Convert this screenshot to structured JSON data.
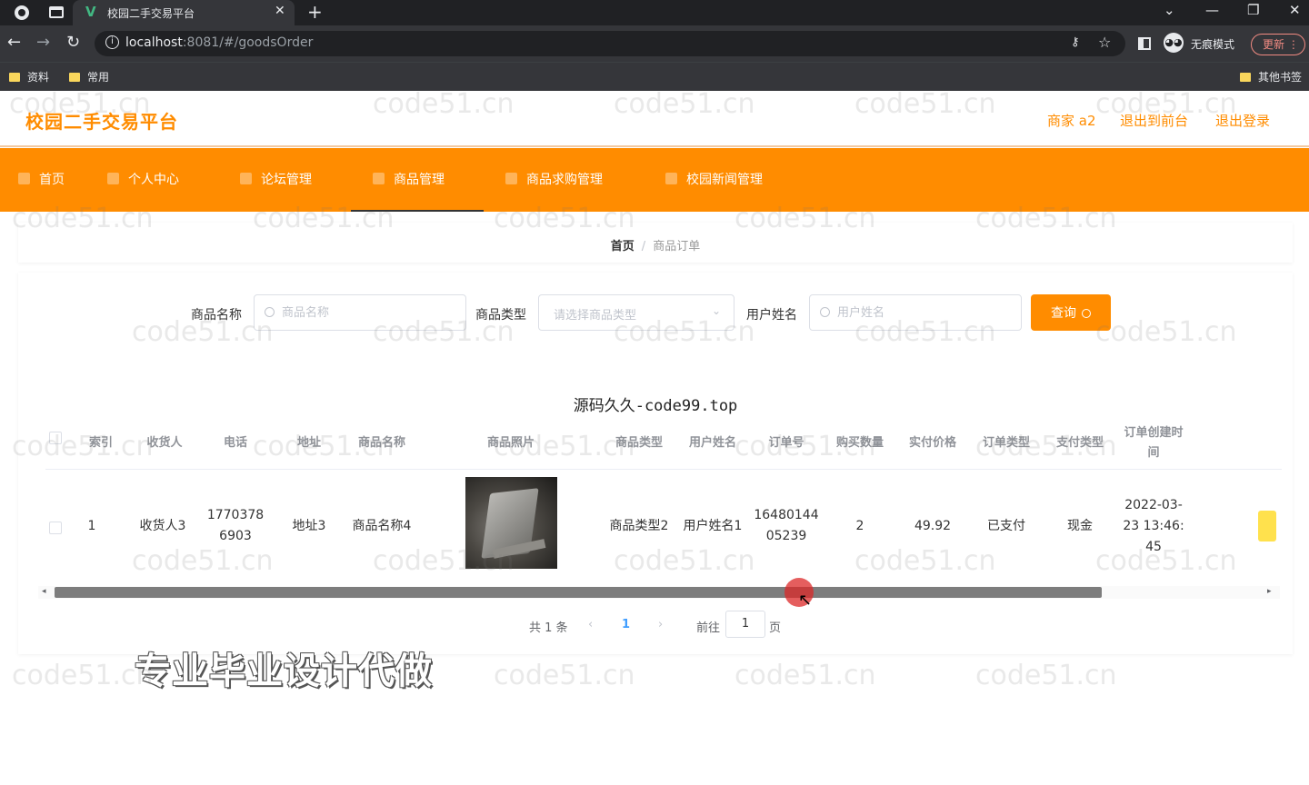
{
  "browser": {
    "tab_title": "校园二手交易平台",
    "tab_close": "✕",
    "new_tab": "+",
    "url_host": "localhost",
    "url_path": ":8081/#/goodsOrder",
    "incognito_label": "无痕模式",
    "update_label": "更新",
    "bookmarks": [
      "资料",
      "常用"
    ],
    "other_bookmarks": "其他书签"
  },
  "header": {
    "site_title": "校园二手交易平台",
    "merchant": "商家 a2",
    "back_to_front": "退出到前台",
    "logout": "退出登录"
  },
  "nav": {
    "items": [
      "首页",
      "个人中心",
      "论坛管理",
      "商品管理",
      "商品求购管理",
      "校园新闻管理"
    ],
    "active_index": 3
  },
  "breadcrumb": {
    "home": "首页",
    "separator": "/",
    "current": "商品订单"
  },
  "search": {
    "goods_name_label": "商品名称",
    "goods_name_placeholder": "商品名称",
    "goods_type_label": "商品类型",
    "goods_type_placeholder": "请选择商品类型",
    "user_name_label": "用户姓名",
    "user_name_placeholder": "用户姓名",
    "query_button": "查询"
  },
  "table": {
    "title": "源码久久-code99.top",
    "columns": [
      "索引",
      "收货人",
      "电话",
      "地址",
      "商品名称",
      "商品照片",
      "商品类型",
      "用户姓名",
      "订单号",
      "购买数量",
      "实付价格",
      "订单类型",
      "支付类型",
      "订单创建时间"
    ],
    "rows": [
      {
        "index": "1",
        "receiver": "收货人3",
        "phone": "17703786903",
        "address": "地址3",
        "goods_name": "商品名称4",
        "goods_type": "商品类型2",
        "user_name": "用户姓名1",
        "order_no": "1648014405239",
        "quantity": "2",
        "price": "49.92",
        "order_type": "已支付",
        "pay_type": "现金",
        "created_at": "2022-03-23 13:46:45"
      }
    ]
  },
  "pagination": {
    "total": "共 1 条",
    "prev": "‹",
    "page": "1",
    "next": "›",
    "goto": "前往",
    "goto_value": "1",
    "page_unit": "页"
  },
  "overlay": {
    "promo_text": "专业毕业设计代做",
    "watermark": "code51.cn"
  }
}
